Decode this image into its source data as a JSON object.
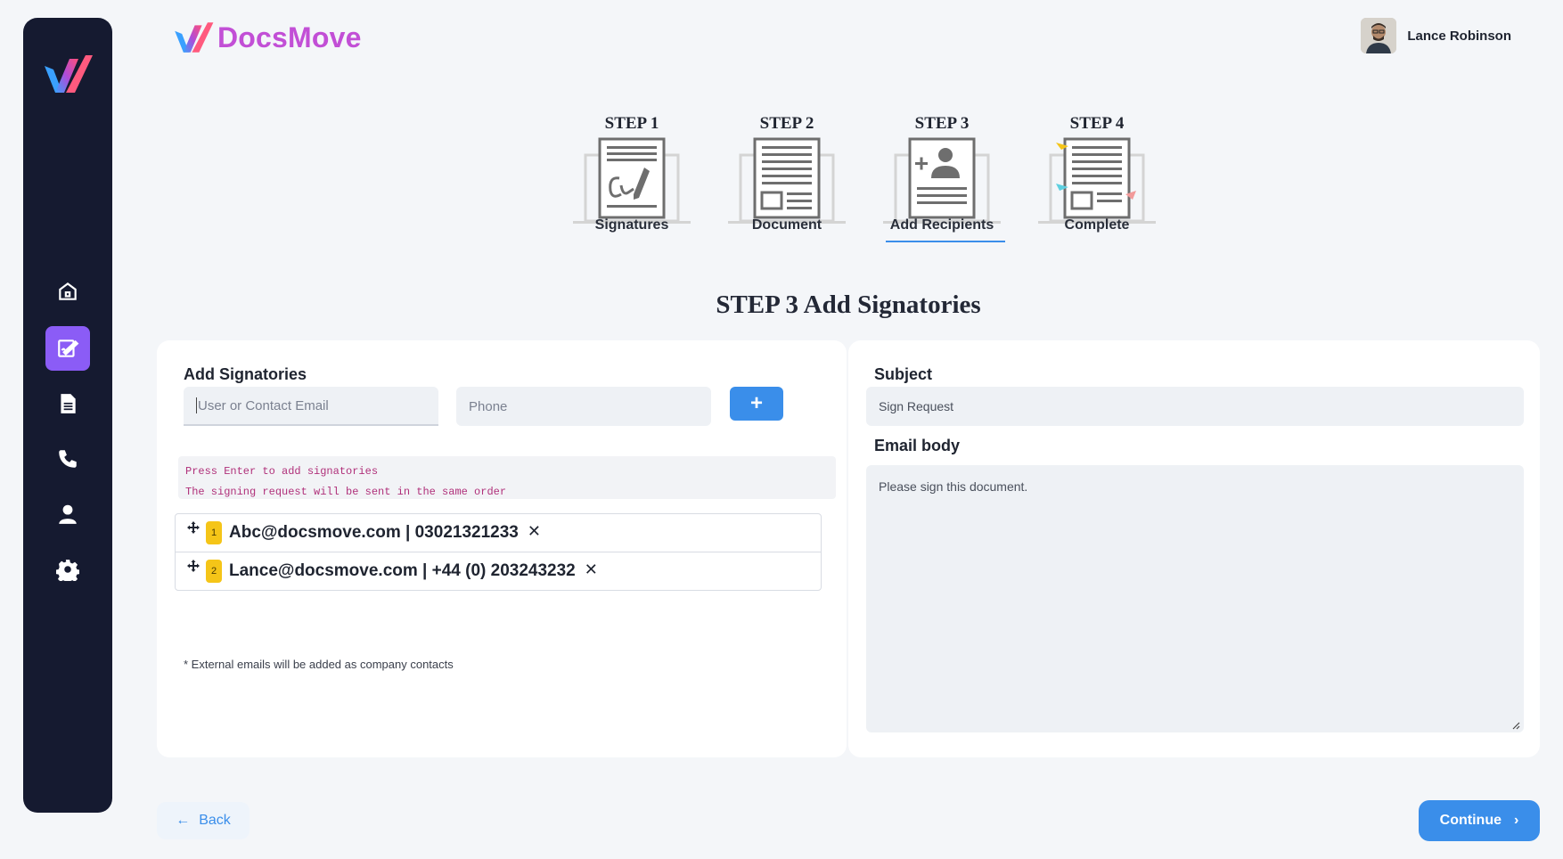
{
  "brand": {
    "name": "DocsMove"
  },
  "user": {
    "name": "Lance Robinson"
  },
  "sidebar": {
    "items": [
      {
        "icon": "home-icon"
      },
      {
        "icon": "sign-document-icon",
        "active": true
      },
      {
        "icon": "document-icon"
      },
      {
        "icon": "phone-icon"
      },
      {
        "icon": "user-icon"
      },
      {
        "icon": "gear-icon"
      }
    ]
  },
  "steps": [
    {
      "title": "STEP 1",
      "label": "Signatures"
    },
    {
      "title": "STEP 2",
      "label": "Document"
    },
    {
      "title": "STEP 3",
      "label": "Add Recipients",
      "active": true
    },
    {
      "title": "STEP 4",
      "label": "Complete"
    }
  ],
  "section_title": "STEP 3 Add Signatories",
  "signatories": {
    "label": "Add Signatories",
    "email_placeholder": "User or Contact Email",
    "phone_placeholder": "Phone",
    "add_label": "+",
    "hints": [
      "Press Enter to add signatories",
      "The signing request will be sent in the same order"
    ],
    "list": [
      {
        "order": "1",
        "text": "Abc@docsmove.com | 03021321233"
      },
      {
        "order": "2",
        "text": "Lance@docsmove.com | +44 (0) 203243232"
      }
    ],
    "remove_label": "✕",
    "note": "* External emails will be added as company contacts"
  },
  "email": {
    "subject_label": "Subject",
    "subject_value": "Sign Request",
    "body_label": "Email body",
    "body_value": "Please sign this document."
  },
  "footer": {
    "back_label": "Back",
    "continue_label": "Continue"
  },
  "colors": {
    "sidebar_bg": "#151a30",
    "accent_purple": "#8b5cf6",
    "primary_blue": "#3a8eea",
    "brand_magenta": "#c24fd6",
    "badge_yellow": "#f5c518"
  }
}
